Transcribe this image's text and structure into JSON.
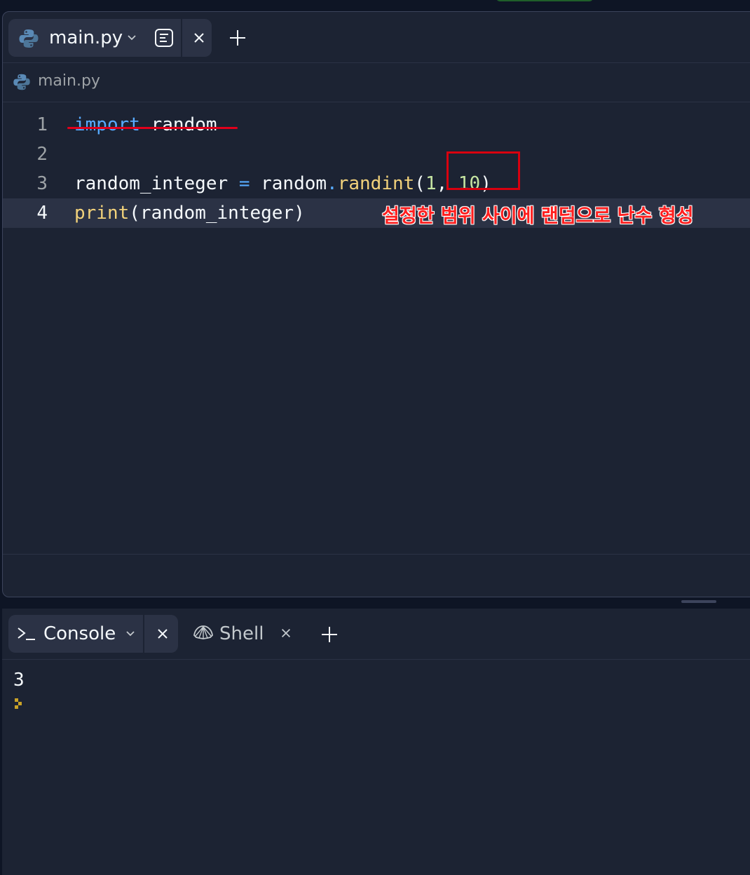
{
  "editor": {
    "tab": {
      "label": "main.py",
      "icon": "python-icon"
    },
    "breadcrumb": {
      "label": "main.py",
      "icon": "python-icon"
    },
    "lines": [
      {
        "number": "1",
        "tokens": [
          {
            "t": "import",
            "c": "kw"
          },
          {
            "t": " random",
            "c": ""
          }
        ]
      },
      {
        "number": "2",
        "tokens": []
      },
      {
        "number": "3",
        "tokens": [
          {
            "t": "random_integer ",
            "c": ""
          },
          {
            "t": "=",
            "c": "op"
          },
          {
            "t": " random",
            "c": ""
          },
          {
            "t": ".",
            "c": "op"
          },
          {
            "t": "randint",
            "c": "fn"
          },
          {
            "t": "(",
            "c": ""
          },
          {
            "t": "1",
            "c": "num"
          },
          {
            "t": ", ",
            "c": ""
          },
          {
            "t": "10",
            "c": "num"
          },
          {
            "t": ")",
            "c": ""
          }
        ]
      },
      {
        "number": "4",
        "tokens": [
          {
            "t": "print",
            "c": "fn"
          },
          {
            "t": "(random_integer)",
            "c": ""
          }
        ]
      }
    ],
    "current_line": 4,
    "annotation": "설정한 범위 사이에 랜덤으로 난수 형성"
  },
  "console": {
    "tabs": [
      {
        "label": "Console",
        "icon": "terminal-prompt-icon",
        "active": true
      },
      {
        "label": "Shell",
        "icon": "shell-icon",
        "active": false
      }
    ],
    "output": "3"
  },
  "colors": {
    "background": "#1c2333",
    "keyword": "#57abff",
    "function": "#f2d27b",
    "number": "#c6e5a2",
    "annotation": "#ff1f1f"
  }
}
